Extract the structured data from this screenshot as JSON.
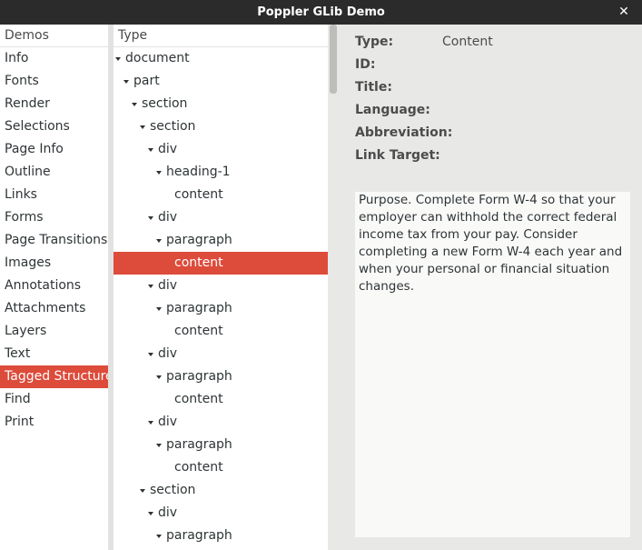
{
  "window": {
    "title": "Poppler GLib Demo",
    "close_glyph": "✕"
  },
  "demos": {
    "header": "Demos",
    "items": [
      "Info",
      "Fonts",
      "Render",
      "Selections",
      "Page Info",
      "Outline",
      "Links",
      "Forms",
      "Page Transitions",
      "Images",
      "Annotations",
      "Attachments",
      "Layers",
      "Text",
      "Tagged Structure",
      "Find",
      "Print"
    ],
    "selected": "Tagged Structure"
  },
  "structure": {
    "header": "Type",
    "rows": [
      {
        "label": "document",
        "depth": 0,
        "expander": true
      },
      {
        "label": "part",
        "depth": 1,
        "expander": true
      },
      {
        "label": "section",
        "depth": 2,
        "expander": true
      },
      {
        "label": "section",
        "depth": 3,
        "expander": true
      },
      {
        "label": "div",
        "depth": 4,
        "expander": true
      },
      {
        "label": "heading-1",
        "depth": 5,
        "expander": true
      },
      {
        "label": "content",
        "depth": 6,
        "expander": false
      },
      {
        "label": "div",
        "depth": 4,
        "expander": true
      },
      {
        "label": "paragraph",
        "depth": 5,
        "expander": true
      },
      {
        "label": "content",
        "depth": 6,
        "expander": false,
        "selected": true
      },
      {
        "label": "div",
        "depth": 4,
        "expander": true
      },
      {
        "label": "paragraph",
        "depth": 5,
        "expander": true
      },
      {
        "label": "content",
        "depth": 6,
        "expander": false
      },
      {
        "label": "div",
        "depth": 4,
        "expander": true
      },
      {
        "label": "paragraph",
        "depth": 5,
        "expander": true
      },
      {
        "label": "content",
        "depth": 6,
        "expander": false
      },
      {
        "label": "div",
        "depth": 4,
        "expander": true
      },
      {
        "label": "paragraph",
        "depth": 5,
        "expander": true
      },
      {
        "label": "content",
        "depth": 6,
        "expander": false
      },
      {
        "label": "section",
        "depth": 3,
        "expander": true
      },
      {
        "label": "div",
        "depth": 4,
        "expander": true
      },
      {
        "label": "paragraph",
        "depth": 5,
        "expander": true
      }
    ]
  },
  "details": {
    "type_label": "Type:",
    "type_value": "Content",
    "id_label": "ID:",
    "title_label": "Title:",
    "language_label": "Language:",
    "abbreviation_label": "Abbreviation:",
    "link_target_label": "Link Target:",
    "text": "Purpose. Complete Form W-4 so that your employer can withhold the correct federal income tax from your pay. Consider completing a new Form W-4 each year and when your personal or financial situation changes."
  },
  "colors": {
    "selection": "#dd4b3b",
    "titlebar": "#2b2b2b"
  }
}
